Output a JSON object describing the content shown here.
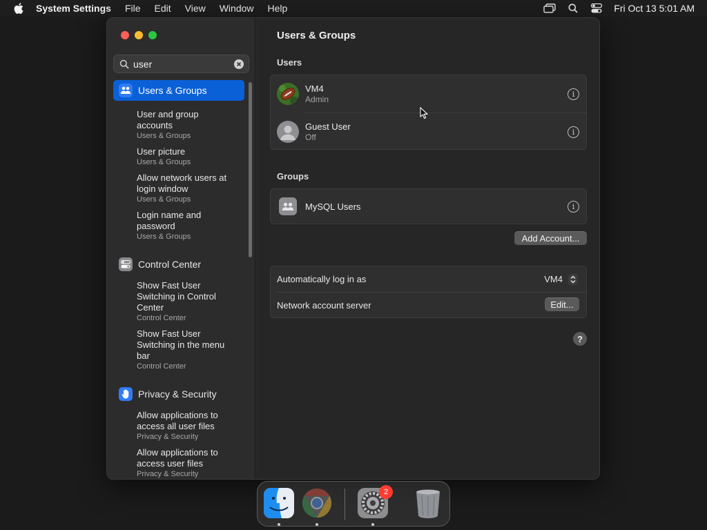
{
  "menubar": {
    "app_name": "System Settings",
    "menus": [
      "File",
      "Edit",
      "View",
      "Window",
      "Help"
    ],
    "clock": "Fri Oct 13  5:01 AM"
  },
  "sidebar": {
    "search": {
      "value": "user",
      "placeholder": "Search"
    },
    "sections": [
      {
        "label": "Users & Groups",
        "icon": "users-groups-icon",
        "selected": true,
        "results": [
          {
            "title": "User and group accounts",
            "category": "Users & Groups"
          },
          {
            "title": "User picture",
            "category": "Users & Groups"
          },
          {
            "title": "Allow network users at login window",
            "category": "Users & Groups"
          },
          {
            "title": "Login name and password",
            "category": "Users & Groups"
          }
        ]
      },
      {
        "label": "Control Center",
        "icon": "control-center-icon",
        "results": [
          {
            "title": "Show Fast User Switching in Control Center",
            "category": "Control Center"
          },
          {
            "title": "Show Fast User Switching in the menu bar",
            "category": "Control Center"
          }
        ]
      },
      {
        "label": "Privacy & Security",
        "icon": "hand-icon",
        "results": [
          {
            "title": "Allow applications to access all user files",
            "category": "Privacy & Security"
          },
          {
            "title": "Allow applications to access user files",
            "category": "Privacy & Security"
          }
        ]
      }
    ]
  },
  "main": {
    "title": "Users & Groups",
    "users_header": "Users",
    "users": [
      {
        "name": "VM4",
        "role": "Admin"
      },
      {
        "name": "Guest User",
        "role": "Off"
      }
    ],
    "groups_header": "Groups",
    "groups": [
      {
        "name": "MySQL Users"
      }
    ],
    "add_account_label": "Add Account...",
    "auto_login_label": "Automatically log in as",
    "auto_login_value": "VM4",
    "network_server_label": "Network account server",
    "edit_label": "Edit...",
    "help_label": "?"
  },
  "dock": {
    "badge_count": "2",
    "apps": [
      "finder-icon",
      "chrome-icon",
      "system-settings-icon",
      "trash-icon"
    ]
  },
  "colors": {
    "accent": "#0a60d6",
    "close": "#fe5f57",
    "minimize": "#febc2e",
    "maximize": "#28c840",
    "badge": "#ff3b30"
  }
}
